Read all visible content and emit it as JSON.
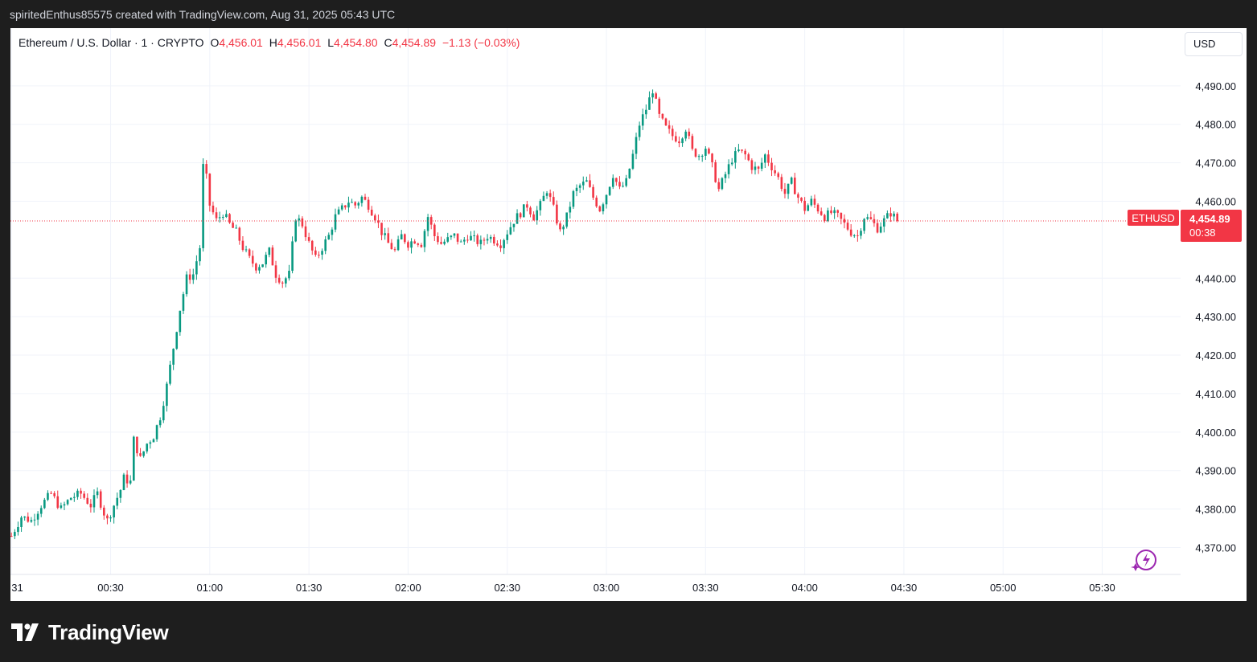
{
  "attribution": "spiritedEnthus85575 created with TradingView.com, Aug 31, 2025 05:43 UTC",
  "legend": {
    "symbol": "Ethereum / U.S. Dollar · 1 · CRYPTO",
    "o_label": "O",
    "o_value": "4,456.01",
    "h_label": "H",
    "h_value": "4,456.01",
    "l_label": "L",
    "l_value": "4,454.80",
    "c_label": "C",
    "c_value": "4,454.89",
    "change": "−1.13 (−0.03%)"
  },
  "currency_button": "USD",
  "price_label": {
    "symbol": "ETHUSD",
    "price": "4,454.89",
    "countdown": "00:38"
  },
  "footer": {
    "brand": "TradingView"
  },
  "colors": {
    "up": "#089981",
    "down": "#f23645",
    "grid": "#f0f3fa",
    "text": "#131722"
  },
  "chart_data": {
    "type": "candlestick",
    "title": "Ethereum / U.S. Dollar · 1 · CRYPTO",
    "ylim": [
      4363,
      4505
    ],
    "y_ticks": [
      4370,
      4380,
      4390,
      4400,
      4410,
      4420,
      4430,
      4440,
      4460,
      4470,
      4480,
      4490
    ],
    "y_tick_labels": [
      "4,370.00",
      "4,380.00",
      "4,390.00",
      "4,400.00",
      "4,410.00",
      "4,420.00",
      "4,430.00",
      "4,440.00",
      "4,460.00",
      "4,470.00",
      "4,480.00",
      "4,490.00"
    ],
    "x_ticks": [
      {
        "minute": -30,
        "label": "31"
      },
      {
        "minute": 0,
        "label": "00:30"
      },
      {
        "minute": 30,
        "label": "01:00"
      },
      {
        "minute": 60,
        "label": "01:30"
      },
      {
        "minute": 90,
        "label": "02:00"
      },
      {
        "minute": 120,
        "label": "02:30"
      },
      {
        "minute": 150,
        "label": "03:00"
      },
      {
        "minute": 180,
        "label": "03:30"
      },
      {
        "minute": 210,
        "label": "04:00"
      },
      {
        "minute": 240,
        "label": "04:30"
      },
      {
        "minute": 270,
        "label": "05:00"
      },
      {
        "minute": 300,
        "label": "05:30"
      }
    ],
    "last_price": 4454.89,
    "price_points": [
      [
        -30,
        4373
      ],
      [
        -27,
        4378
      ],
      [
        -24,
        4377
      ],
      [
        -21,
        4381
      ],
      [
        -18,
        4384
      ],
      [
        -15,
        4380
      ],
      [
        -12,
        4383
      ],
      [
        -9,
        4384
      ],
      [
        -6,
        4381
      ],
      [
        -4,
        4384
      ],
      [
        -2,
        4379
      ],
      [
        -1,
        4377
      ],
      [
        1,
        4381
      ],
      [
        3,
        4385
      ],
      [
        4,
        4388
      ],
      [
        6,
        4387
      ],
      [
        7,
        4398
      ],
      [
        9,
        4393
      ],
      [
        11,
        4397
      ],
      [
        13,
        4399
      ],
      [
        15,
        4404
      ],
      [
        17,
        4412
      ],
      [
        19,
        4422
      ],
      [
        21,
        4432
      ],
      [
        23,
        4440
      ],
      [
        25,
        4441
      ],
      [
        27,
        4448
      ],
      [
        28,
        4469
      ],
      [
        29,
        4466
      ],
      [
        30,
        4459
      ],
      [
        32,
        4455
      ],
      [
        34,
        4457
      ],
      [
        36,
        4454
      ],
      [
        38,
        4452
      ],
      [
        40,
        4448
      ],
      [
        42,
        4445
      ],
      [
        44,
        4443
      ],
      [
        46,
        4444
      ],
      [
        48,
        4447
      ],
      [
        50,
        4441
      ],
      [
        52,
        4439
      ],
      [
        54,
        4441
      ],
      [
        56,
        4456
      ],
      [
        58,
        4454
      ],
      [
        60,
        4449
      ],
      [
        62,
        4445
      ],
      [
        64,
        4448
      ],
      [
        66,
        4451
      ],
      [
        68,
        4456
      ],
      [
        70,
        4458
      ],
      [
        72,
        4460
      ],
      [
        74,
        4459
      ],
      [
        76,
        4461
      ],
      [
        78,
        4459
      ],
      [
        80,
        4456
      ],
      [
        82,
        4452
      ],
      [
        84,
        4449
      ],
      [
        86,
        4447
      ],
      [
        88,
        4451
      ],
      [
        90,
        4449
      ],
      [
        92,
        4450
      ],
      [
        94,
        4449
      ],
      [
        96,
        4456
      ],
      [
        98,
        4451
      ],
      [
        100,
        4449
      ],
      [
        102,
        4450
      ],
      [
        104,
        4451
      ],
      [
        106,
        4449
      ],
      [
        108,
        4451
      ],
      [
        110,
        4450
      ],
      [
        112,
        4449
      ],
      [
        114,
        4451
      ],
      [
        116,
        4450
      ],
      [
        118,
        4449
      ],
      [
        120,
        4452
      ],
      [
        122,
        4455
      ],
      [
        124,
        4457
      ],
      [
        126,
        4459
      ],
      [
        128,
        4456
      ],
      [
        130,
        4459
      ],
      [
        132,
        4463
      ],
      [
        134,
        4458
      ],
      [
        136,
        4452
      ],
      [
        138,
        4456
      ],
      [
        140,
        4462
      ],
      [
        142,
        4464
      ],
      [
        144,
        4465
      ],
      [
        146,
        4461
      ],
      [
        148,
        4458
      ],
      [
        150,
        4462
      ],
      [
        152,
        4467
      ],
      [
        154,
        4463
      ],
      [
        156,
        4465
      ],
      [
        158,
        4472
      ],
      [
        160,
        4480
      ],
      [
        162,
        4484
      ],
      [
        164,
        4489
      ],
      [
        166,
        4482
      ],
      [
        168,
        4479
      ],
      [
        170,
        4477
      ],
      [
        172,
        4476
      ],
      [
        174,
        4479
      ],
      [
        176,
        4473
      ],
      [
        178,
        4472
      ],
      [
        180,
        4474
      ],
      [
        182,
        4469
      ],
      [
        184,
        4463
      ],
      [
        186,
        4467
      ],
      [
        188,
        4471
      ],
      [
        190,
        4473
      ],
      [
        192,
        4472
      ],
      [
        194,
        4469
      ],
      [
        196,
        4468
      ],
      [
        198,
        4472
      ],
      [
        200,
        4469
      ],
      [
        202,
        4466
      ],
      [
        204,
        4462
      ],
      [
        206,
        4465
      ],
      [
        208,
        4461
      ],
      [
        210,
        4458
      ],
      [
        212,
        4460
      ],
      [
        214,
        4458
      ],
      [
        216,
        4456
      ],
      [
        218,
        4457
      ],
      [
        220,
        4456
      ],
      [
        222,
        4454
      ],
      [
        224,
        4452
      ],
      [
        226,
        4451
      ],
      [
        228,
        4456
      ],
      [
        230,
        4455
      ],
      [
        232,
        4453
      ],
      [
        234,
        4455
      ],
      [
        236,
        4457
      ],
      [
        238,
        4455
      ]
    ]
  }
}
